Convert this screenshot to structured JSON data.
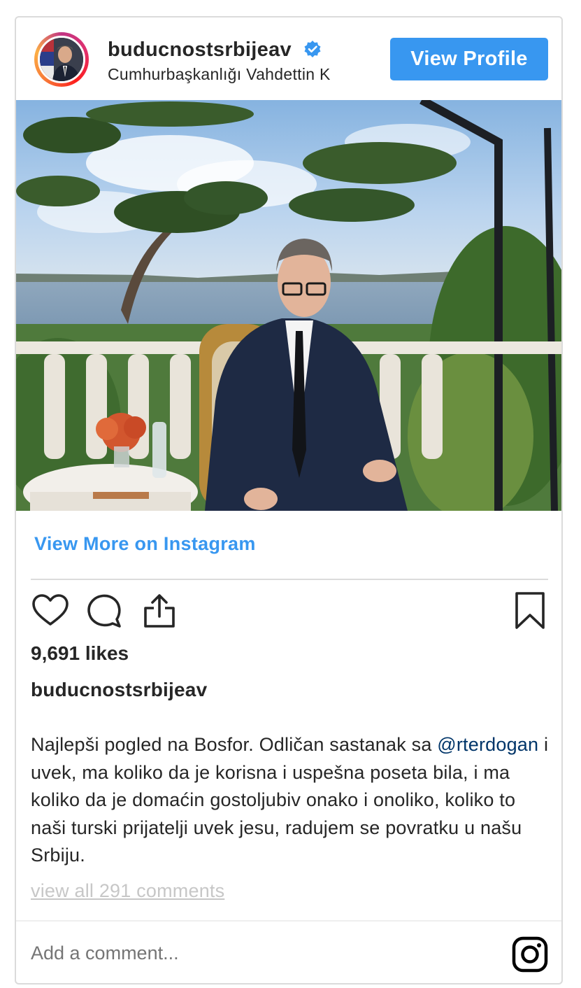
{
  "header": {
    "username": "buducnostsrbijeav",
    "location": "Cumhurbaşkanlığı Vahdettin K",
    "view_profile_label": "View Profile"
  },
  "post": {
    "view_more_label": "View More on Instagram",
    "likes": "9,691 likes",
    "caption_user": "buducnostsrbijeav",
    "caption_part1": "Najlepši pogled na Bosfor. Odličan sastanak sa ",
    "caption_mention": "@rterdogan",
    "caption_part2": " i uvek, ma koliko da je korisna i uspešna poseta bila, i ma koliko da je domaćin gostoljubiv onako i onoliko, koliko to naši turski prijatelji uvek jesu, radujem se povratku u našu Srbiju.",
    "comments_link": "view all 291 comments"
  },
  "comment_box": {
    "placeholder": "Add a comment..."
  },
  "icons": {
    "like": "heart-icon",
    "comment": "comment-icon",
    "share": "share-icon",
    "save": "bookmark-icon",
    "brand": "instagram-icon"
  },
  "colors": {
    "accent": "#3897f0",
    "text": "#262626",
    "muted": "#8e8e8e",
    "mention": "#003569"
  }
}
